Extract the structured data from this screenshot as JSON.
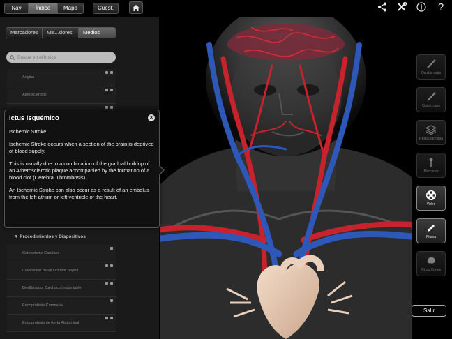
{
  "toolbar": {
    "nav": "Nav",
    "indice": "Índice",
    "mapa": "Mapa",
    "cuest": "Cuest.",
    "home_icon": "home-icon"
  },
  "top_right_icons": [
    "share-icon",
    "tools-icon",
    "info-icon",
    "help-icon"
  ],
  "panel_tabs": [
    "Marcadores",
    "Mis...dores",
    "Medios"
  ],
  "search": {
    "placeholder": "Buscar en el Índice"
  },
  "list_top": [
    "Angina",
    "Aterosclerosis"
  ],
  "section": "Procedimientos y Dispositivos",
  "list_bottom": [
    "Cateterismo Cardíaco",
    "Colocación de un Oclusor Septal",
    "Desfibrilador Cardíaco Implantable",
    "Endoprótesis Coronaria",
    "Endoprótesis de Aorta Abdominal"
  ],
  "popup": {
    "title": "Ictus Isquémico",
    "subtitle": "Ischemic Stroke:",
    "p1": "Ischemic Stroke occurs when a section of the brain is deprived of blood supply.",
    "p2": "This is usually due to a combination of the gradual buildup of an Atherosclerotic plaque accompanied by the formation of a blood clot (Cerebral Thrombosis).",
    "p3": "An Ischemic Stroke can also occur as a result of an embolus from the left atrium or left ventricle of the heart."
  },
  "tools": [
    {
      "label": "Ocultar capa",
      "icon": "wand-icon",
      "active": false
    },
    {
      "label": "Quitar capa",
      "icon": "wand-icon",
      "active": false
    },
    {
      "label": "Restaurar capa",
      "icon": "layers-icon",
      "active": false
    },
    {
      "label": "Marcador",
      "icon": "pin-icon",
      "active": false
    },
    {
      "label": "Video",
      "icon": "film-reel-icon",
      "active": true
    },
    {
      "label": "Pluma",
      "icon": "pen-icon",
      "active": true
    },
    {
      "label": "Otros Cortes",
      "icon": "brain-icon",
      "active": false
    }
  ],
  "exit_label": "Salir",
  "colors": {
    "artery": "#c8232c",
    "vein": "#2e58b8",
    "panel": "#1a1a1a"
  }
}
